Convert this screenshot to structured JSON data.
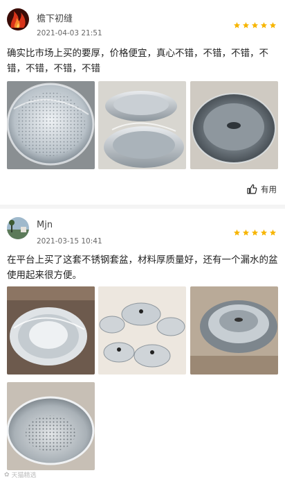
{
  "reviews": [
    {
      "username": "檐下初缝",
      "date": "2021-04-03 21:51",
      "rating": 5,
      "text": "确实比市场上买的要厚，价格便宜，真心不错，不错，不错，不错，不错，不错，不错",
      "photos": [
        "colander-in-plastic-wrap",
        "stacked-steel-bowls",
        "bowls-with-lid"
      ],
      "helpful_label": "有用"
    },
    {
      "username": "Mjn",
      "date": "2021-03-15 10:41",
      "rating": 5,
      "text": "在平台上买了这套不锈钢套盆，材料厚质量好，还有一个漏水的盆使用起来很方便。",
      "photos": [
        "wrapped-basin",
        "lids-set",
        "nested-bowls",
        "colander-basin"
      ]
    }
  ],
  "watermark": "天猫精选",
  "colors": {
    "star": "#f7b500",
    "divider": "#f4f4f4"
  }
}
